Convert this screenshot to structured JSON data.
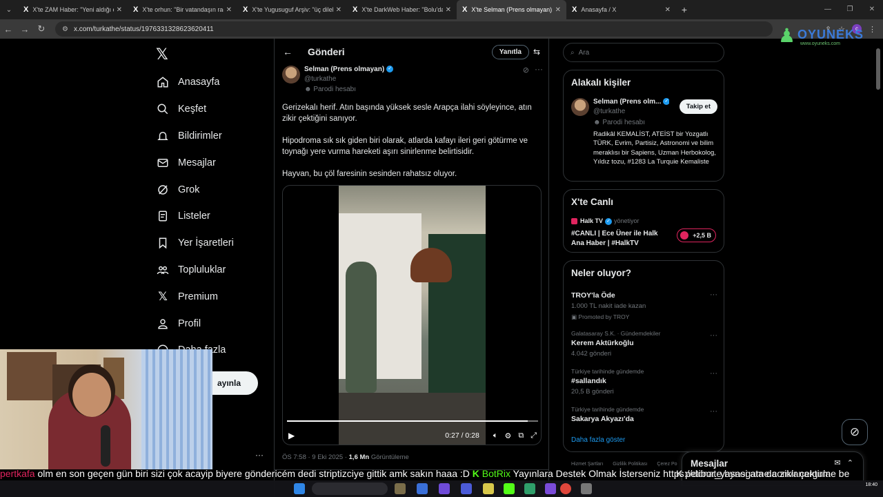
{
  "browser": {
    "tabs": [
      {
        "label": "X'te ZAM Haber: \"Yeni aldığı ev"
      },
      {
        "label": "X'te orhun: \"Bir vatandaşın racı"
      },
      {
        "label": "X'te Yugusuguf Arşiv: \"üç dilek"
      },
      {
        "label": "X'te DarkWeb Haber: \"Bolu'da"
      },
      {
        "label": "X'te Selman (Prens olmayan): \""
      },
      {
        "label": "Anasayfa / X"
      }
    ],
    "url": "x.com/turkathe/status/1976331328623620411"
  },
  "brand": {
    "name": "OYUNEKS",
    "url": "www.oyuneks.com"
  },
  "nav": {
    "items": [
      {
        "label": "Anasayfa",
        "icon": "home-icon"
      },
      {
        "label": "Keşfet",
        "icon": "search-icon"
      },
      {
        "label": "Bildirimler",
        "icon": "bell-icon"
      },
      {
        "label": "Mesajlar",
        "icon": "mail-icon"
      },
      {
        "label": "Grok",
        "icon": "grok-icon"
      },
      {
        "label": "Listeler",
        "icon": "list-icon"
      },
      {
        "label": "Yer İşaretleri",
        "icon": "bookmark-icon"
      },
      {
        "label": "Topluluklar",
        "icon": "communities-icon"
      },
      {
        "label": "Premium",
        "icon": "x-premium-icon"
      },
      {
        "label": "Profil",
        "icon": "profile-icon"
      },
      {
        "label": "Daha fazla",
        "icon": "more-circle-icon"
      }
    ],
    "post_label": "ayınla",
    "more_dots": "···"
  },
  "main": {
    "header_title": "Gönderi",
    "reply_label": "Yanıtla",
    "author": {
      "name": "Selman (Prens olmayan)",
      "handle": "@turkathe",
      "parody": "Parodi hesabı"
    },
    "paragraphs": [
      "Gerizekalı herif. Atın başında yüksek sesle Arapça ilahi söyleyince, atın zikir çektiğini sanıyor.",
      "Hipodroma sık sık giden biri olarak, atlarda kafayı ileri geri götürme ve toynağı yere vurma hareketi aşırı sinirlenme belirtisidir.",
      "Hayvan, bu çöl faresinin sesinden rahatsız oluyor."
    ],
    "video": {
      "time": "0:27 / 0:28",
      "progress": 0.96
    },
    "meta": {
      "datetime": "ÖS 7:58 · 9 Eki 2025 · ",
      "views": "1,6 Mn",
      "views_label": " Görüntüleme"
    }
  },
  "right": {
    "search_placeholder": "Ara",
    "related": {
      "title": "Alakalı kişiler",
      "name": "Selman (Prens olm...",
      "handle": "@turkathe",
      "parody": "Parodi hesabı",
      "follow_label": "Takip et",
      "bio": "Radikâl KEMALİST, ATEİST bir Yozgatlı TÜRK, Evrim, Partisiz, Astronomi ve bilim meraklısı bir Sapiens, Uzman Herbokolog, Yıldız tozu, #1283 La Turquie Kemaliste"
    },
    "live": {
      "title": "X'te Canlı",
      "channel": "Halk TV",
      "channel_sub": "yönetiyor",
      "stream_title": "#CANLI | Ece Üner ile Halk Ana Haber | #HalkTV",
      "listeners": "+2,5 B"
    },
    "trends": {
      "title": "Neler oluyor?",
      "items": [
        {
          "context": "",
          "title": "TROY'la Öde",
          "sub": "1.000 TL nakit iade kazan",
          "promo": "Promoted by TROY"
        },
        {
          "context": "Galatasaray S.K. · Gündemdekiler",
          "title": "Kerem Aktürkoğlu",
          "sub": "4.042 gönderi",
          "promo": ""
        },
        {
          "context": "Türkiye tarihinde gündemde",
          "title": "#sallandık",
          "sub": "20,5 B gönderi",
          "promo": ""
        },
        {
          "context": "Türkiye tarihinde gündemde",
          "title": "Sakarya Akyazı'da",
          "sub": "",
          "promo": ""
        }
      ],
      "show_more": "Daha fazla göster"
    },
    "footer": [
      "Hizmet Şartları",
      "Gizlilik Politikası",
      "Çerez Po"
    ]
  },
  "messages_drawer": {
    "title": "Mesajlar"
  },
  "ticker": {
    "user1": "pertkafa",
    "msg1": " olm en son geçen gün biri sizi çok acayip biyere göndericém dedi striptizciye gittik amk sakın haaa :D ",
    "user2": "BotRix",
    "msg2": " Yayınlara Destek Olmak İsterseniz https://donate.bynogame.com/anargula",
    "user3": "petibor_yasasi",
    "msg3": " ata da zikir çektirme be"
  },
  "taskbar": {
    "time": "18:40"
  }
}
